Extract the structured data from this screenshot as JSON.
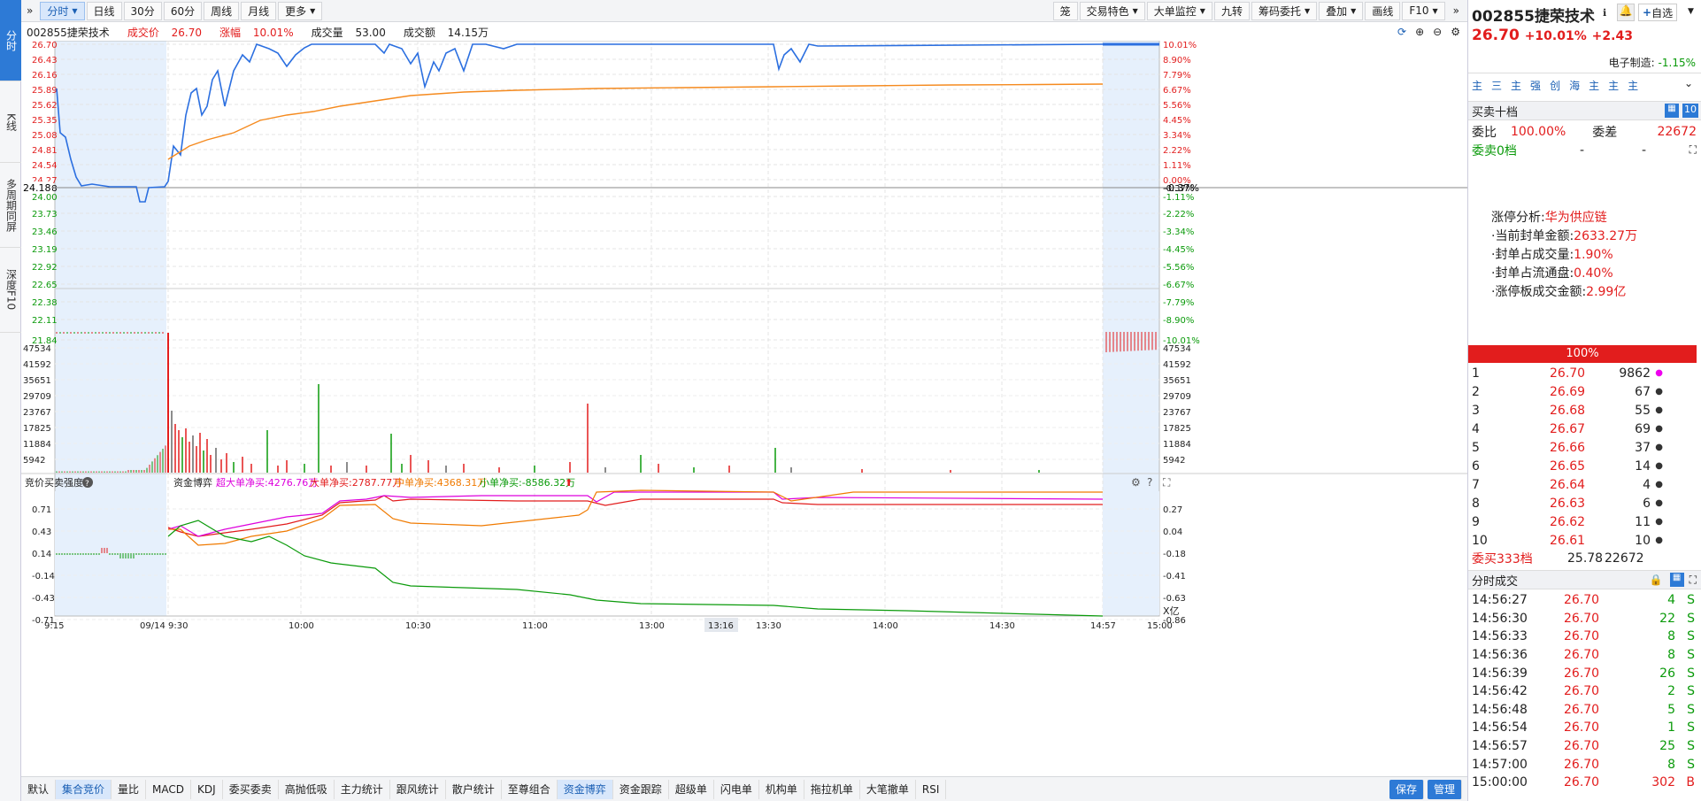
{
  "sidebar": {
    "items": [
      {
        "label": "分时"
      },
      {
        "label": "K线"
      },
      {
        "label": "多周期同屏"
      },
      {
        "label": "深度F10"
      }
    ]
  },
  "topbar": {
    "left_icon": "chevron-double-right-icon",
    "tabs": [
      {
        "label": "分时",
        "active": true,
        "dropdown": true
      },
      {
        "label": "日线"
      },
      {
        "label": "30分"
      },
      {
        "label": "60分"
      },
      {
        "label": "周线"
      },
      {
        "label": "月线"
      },
      {
        "label": "更多",
        "dropdown": true
      }
    ],
    "right_tools": [
      {
        "label": "笼"
      },
      {
        "label": "交易特色",
        "dropdown": true
      },
      {
        "label": "大单监控",
        "dropdown": true
      },
      {
        "label": "九转"
      },
      {
        "label": "筹码委托",
        "dropdown": true
      },
      {
        "label": "叠加",
        "dropdown": true
      },
      {
        "label": "画线"
      },
      {
        "label": "F10",
        "dropdown": true
      }
    ]
  },
  "info": {
    "stock": "002855捷荣技术",
    "price_label": "成交价",
    "price": "26.70",
    "change_label": "涨幅",
    "change": "10.01%",
    "vol_label": "成交量",
    "vol": "53.00",
    "amount_label": "成交额",
    "amount": "14.15万"
  },
  "price_axis": {
    "left": [
      "26.70",
      "26.43",
      "26.16",
      "25.89",
      "25.62",
      "25.35",
      "25.08",
      "24.81",
      "24.54",
      "24.27",
      "24.18",
      "24.00",
      "23.73",
      "23.46",
      "23.19",
      "22.92",
      "22.65",
      "22.38",
      "22.11",
      "21.84"
    ],
    "right": [
      "10.01%",
      "8.90%",
      "7.79%",
      "6.67%",
      "5.56%",
      "4.45%",
      "3.34%",
      "2.22%",
      "1.11%",
      "0.00%",
      "-0.37%",
      "-1.11%",
      "-2.22%",
      "-3.34%",
      "-4.45%",
      "-5.56%",
      "-6.67%",
      "-7.79%",
      "-8.90%",
      "-10.01%"
    ],
    "cursor_left": "24.18",
    "cursor_right": "-0.37%"
  },
  "vol_axis": [
    "47534",
    "41592",
    "35651",
    "29709",
    "23767",
    "17825",
    "11884",
    "5942"
  ],
  "flow_panel": {
    "title": "竞价买卖强度",
    "func": "资金博弈",
    "super": "超大单净买:4276.76万",
    "large": "大单净买:2787.77万",
    "mid": "中单净买:4368.31万",
    "small": "小单净买:-8586.32万",
    "left_axis": [
      "0.71",
      "0.43",
      "0.14",
      "-0.14",
      "-0.43",
      "-0.71"
    ],
    "right_axis": [
      "0.27",
      "0.04",
      "-0.18",
      "-0.41",
      "-0.63",
      "-0.86"
    ],
    "unit": "X亿"
  },
  "time_axis": [
    "9:15",
    "09/14 9:30",
    "10:00",
    "10:30",
    "11:00",
    "13:00",
    "13:16",
    "13:30",
    "14:00",
    "14:30",
    "14:57",
    "15:00"
  ],
  "bottombar": {
    "tabs": [
      "默认",
      "集合竞价",
      "量比",
      "MACD",
      "KDJ",
      "委买委卖",
      "高抛低吸",
      "主力统计",
      "跟风统计",
      "散户统计",
      "至尊组合",
      "资金博弈",
      "资金跟踪",
      "超级单",
      "闪电单",
      "机构单",
      "拖拉机单",
      "大笔撤单",
      "RSI"
    ],
    "active": [
      "集合竞价",
      "资金博弈"
    ],
    "save": "保存",
    "manage": "管理"
  },
  "right_panel": {
    "code": "002855",
    "name": "捷荣技术",
    "fav": "自选",
    "price": "26.70",
    "pct": "+10.01%",
    "chg": "+2.43",
    "sector": "电子制造:",
    "sector_pct": "-1.15%",
    "tags": [
      "主",
      "三",
      "主",
      "强",
      "创",
      "海",
      "主",
      "主",
      "主"
    ],
    "book_title": "买卖十档",
    "book_btn": "10",
    "wb_label": "委比",
    "wb": "100.00%",
    "wc_label": "委差",
    "wc": "22672",
    "sell0": "委卖0档",
    "sell0_p": "-",
    "sell0_v": "-",
    "analysis": [
      {
        "k": "涨停分析:",
        "v": "华为供应链"
      },
      {
        "k": "·当前封单金额:",
        "v": "2633.27万"
      },
      {
        "k": "·封单占成交量:",
        "v": "1.90%"
      },
      {
        "k": "·封单占流通盘:",
        "v": "0.40%"
      },
      {
        "k": "·涨停板成交金额:",
        "v": "2.99亿"
      }
    ],
    "pct_bar": "100%",
    "bids": [
      {
        "n": "1",
        "p": "26.70",
        "v": "9862",
        "dot": "#e0e"
      },
      {
        "n": "2",
        "p": "26.69",
        "v": "67"
      },
      {
        "n": "3",
        "p": "26.68",
        "v": "55"
      },
      {
        "n": "4",
        "p": "26.67",
        "v": "69"
      },
      {
        "n": "5",
        "p": "26.66",
        "v": "37"
      },
      {
        "n": "6",
        "p": "26.65",
        "v": "14"
      },
      {
        "n": "7",
        "p": "26.64",
        "v": "4"
      },
      {
        "n": "8",
        "p": "26.63",
        "v": "6"
      },
      {
        "n": "9",
        "p": "26.62",
        "v": "11"
      },
      {
        "n": "10",
        "p": "26.61",
        "v": "10"
      }
    ],
    "buy_total": "委买333档",
    "buy_total_p": "25.78",
    "buy_total_v": "22672",
    "ticks_title": "分时成交",
    "ticks": [
      {
        "t": "14:56:27",
        "p": "26.70",
        "v": "4",
        "s": "S"
      },
      {
        "t": "14:56:30",
        "p": "26.70",
        "v": "22",
        "s": "S"
      },
      {
        "t": "14:56:33",
        "p": "26.70",
        "v": "8",
        "s": "S"
      },
      {
        "t": "14:56:36",
        "p": "26.70",
        "v": "8",
        "s": "S"
      },
      {
        "t": "14:56:39",
        "p": "26.70",
        "v": "26",
        "s": "S"
      },
      {
        "t": "14:56:42",
        "p": "26.70",
        "v": "2",
        "s": "S"
      },
      {
        "t": "14:56:48",
        "p": "26.70",
        "v": "5",
        "s": "S"
      },
      {
        "t": "14:56:54",
        "p": "26.70",
        "v": "1",
        "s": "S"
      },
      {
        "t": "14:56:57",
        "p": "26.70",
        "v": "25",
        "s": "S"
      },
      {
        "t": "14:57:00",
        "p": "26.70",
        "v": "8",
        "s": "S"
      },
      {
        "t": "15:00:00",
        "p": "26.70",
        "v": "302",
        "s": "B"
      }
    ]
  }
}
